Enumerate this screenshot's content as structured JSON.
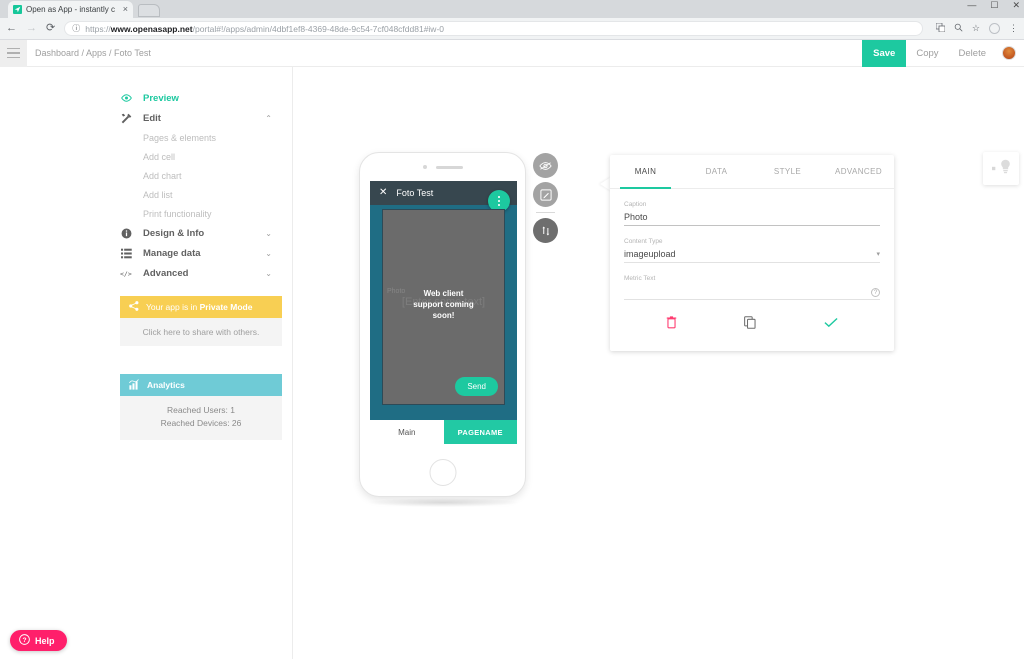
{
  "browser": {
    "tab": {
      "title": "Open as App - instantly c",
      "favicon": "app-favicon",
      "close": "×"
    },
    "back": "←",
    "forward": "→",
    "reload": "⟳",
    "url_scheme": "https://",
    "url_host": "www.openasapp.net",
    "url_path": "/portal#!/apps/admin/4dbf1ef8-4369-48de-9c54-7cf048cfdd81#iw-0",
    "info_icon": "ⓘ",
    "icons": [
      "translate-icon",
      "zoom-icon",
      "bookmark-star-icon",
      "profile-icon",
      "menu-icon"
    ],
    "star": "☆",
    "menu": "⋮",
    "window": {
      "minimize": "—",
      "maximize": "☐",
      "close": "✕"
    }
  },
  "appbar": {
    "breadcrumb": "Dashboard / Apps / Foto Test",
    "save_label": "Save",
    "copy_label": "Copy",
    "delete_label": "Delete"
  },
  "sidebar": {
    "preview": {
      "label": "Preview",
      "icon": "eye-icon"
    },
    "edit": {
      "label": "Edit",
      "icon": "tools-icon",
      "chevron": "⌃"
    },
    "edit_items": [
      {
        "label": "Pages & elements"
      },
      {
        "label": "Add cell"
      },
      {
        "label": "Add chart"
      },
      {
        "label": "Add list"
      },
      {
        "label": "Print functionality"
      }
    ],
    "groups": [
      {
        "label": "Design & Info",
        "icon": "info-icon",
        "chevron": "⌄"
      },
      {
        "label": "Manage data",
        "icon": "list-icon",
        "chevron": "⌄"
      },
      {
        "label": "Advanced",
        "icon": "code-icon",
        "chevron": "⌄"
      }
    ],
    "private_card": {
      "title_prefix": "Your app is in ",
      "title_bold": "Private Mode",
      "body": "Click here to share with others.",
      "icon": "share-icon",
      "color": "#f8cf53"
    },
    "analytics_card": {
      "title": "Analytics",
      "icon": "bar-chart-icon",
      "color": "#6fcbd6",
      "stats": [
        {
          "label": "Reached Users: 1"
        },
        {
          "label": "Reached Devices: 26"
        }
      ]
    }
  },
  "phone": {
    "app_title": "Foto Test",
    "close_icon": "✕",
    "fab": "more-vertical-icon",
    "photo_label": "Photo",
    "photo_placeholder": "[Enter some text]",
    "overlay_line1": "Web client",
    "overlay_line2": "support coming",
    "overlay_line3": "soon!",
    "send_label": "Send",
    "tabs": [
      {
        "label": "Main",
        "active": false
      },
      {
        "label": "PAGENAME",
        "active": true
      }
    ],
    "header_color": "#37474f",
    "accent_color": "#1dc9a0"
  },
  "tools": [
    {
      "name": "eye-off-icon"
    },
    {
      "name": "edit-square-icon"
    },
    {
      "name": "move-vertical-icon"
    }
  ],
  "panel": {
    "tabs": [
      {
        "label": "MAIN",
        "active": true
      },
      {
        "label": "DATA",
        "active": false
      },
      {
        "label": "STYLE",
        "active": false
      },
      {
        "label": "ADVANCED",
        "active": false
      }
    ],
    "fields": [
      {
        "label": "Caption",
        "value": "Photo"
      },
      {
        "label": "Content Type",
        "value": "imageupload",
        "caret": "▾"
      },
      {
        "label": "Metric Text",
        "value": "",
        "help": "?"
      }
    ],
    "actions": [
      {
        "name": "delete-icon",
        "color": "#ff3d71"
      },
      {
        "name": "duplicate-icon",
        "color": "#6e6e6e"
      },
      {
        "name": "confirm-check-icon",
        "color": "#1dc9a0"
      }
    ]
  },
  "tip_panel": {
    "icon": "lightbulb-icon"
  },
  "help": {
    "label": "Help",
    "icon": "question-circle-icon",
    "color": "#ff1f6b"
  }
}
